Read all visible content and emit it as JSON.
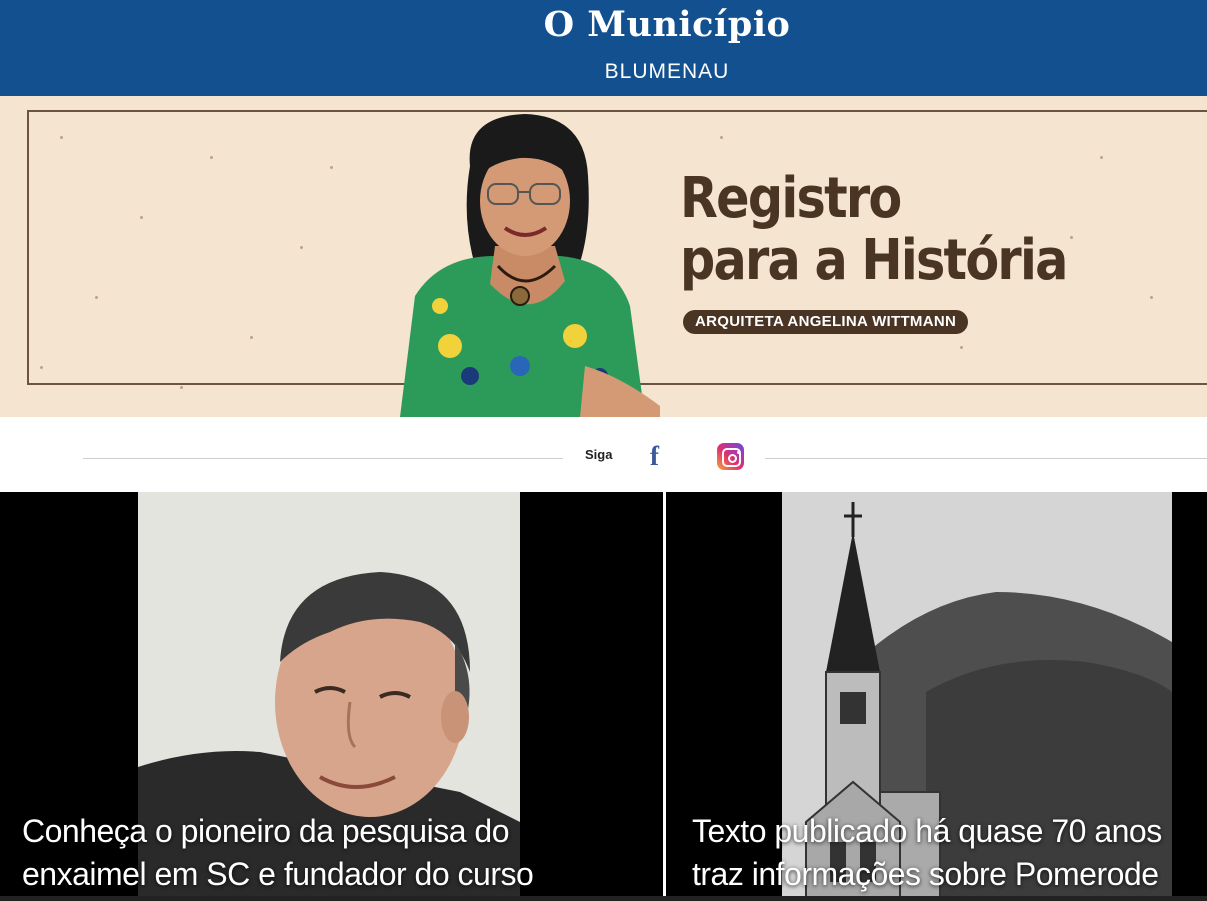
{
  "header": {
    "logo": "O Município",
    "city": "BLUMENAU",
    "brand_color": "#12508f"
  },
  "banner": {
    "title_line1": "Registro",
    "title_line2": "para a História",
    "author_tag": "ARQUITETA ANGELINA WITTMANN",
    "background": "#f5e4cf",
    "text_color": "#4a3424"
  },
  "follow": {
    "label": "Siga",
    "facebook_icon": "facebook-icon",
    "instagram_icon": "instagram-icon"
  },
  "articles": [
    {
      "title_line1": "Conheça o pioneiro da pesquisa do",
      "title_line2": "enxaimel em SC e fundador do curso",
      "image": "portrait-photo"
    },
    {
      "title_line1": "Texto publicado há quase 70 anos",
      "title_line2": "traz informações sobre Pomerode",
      "image": "church-engraving"
    }
  ]
}
